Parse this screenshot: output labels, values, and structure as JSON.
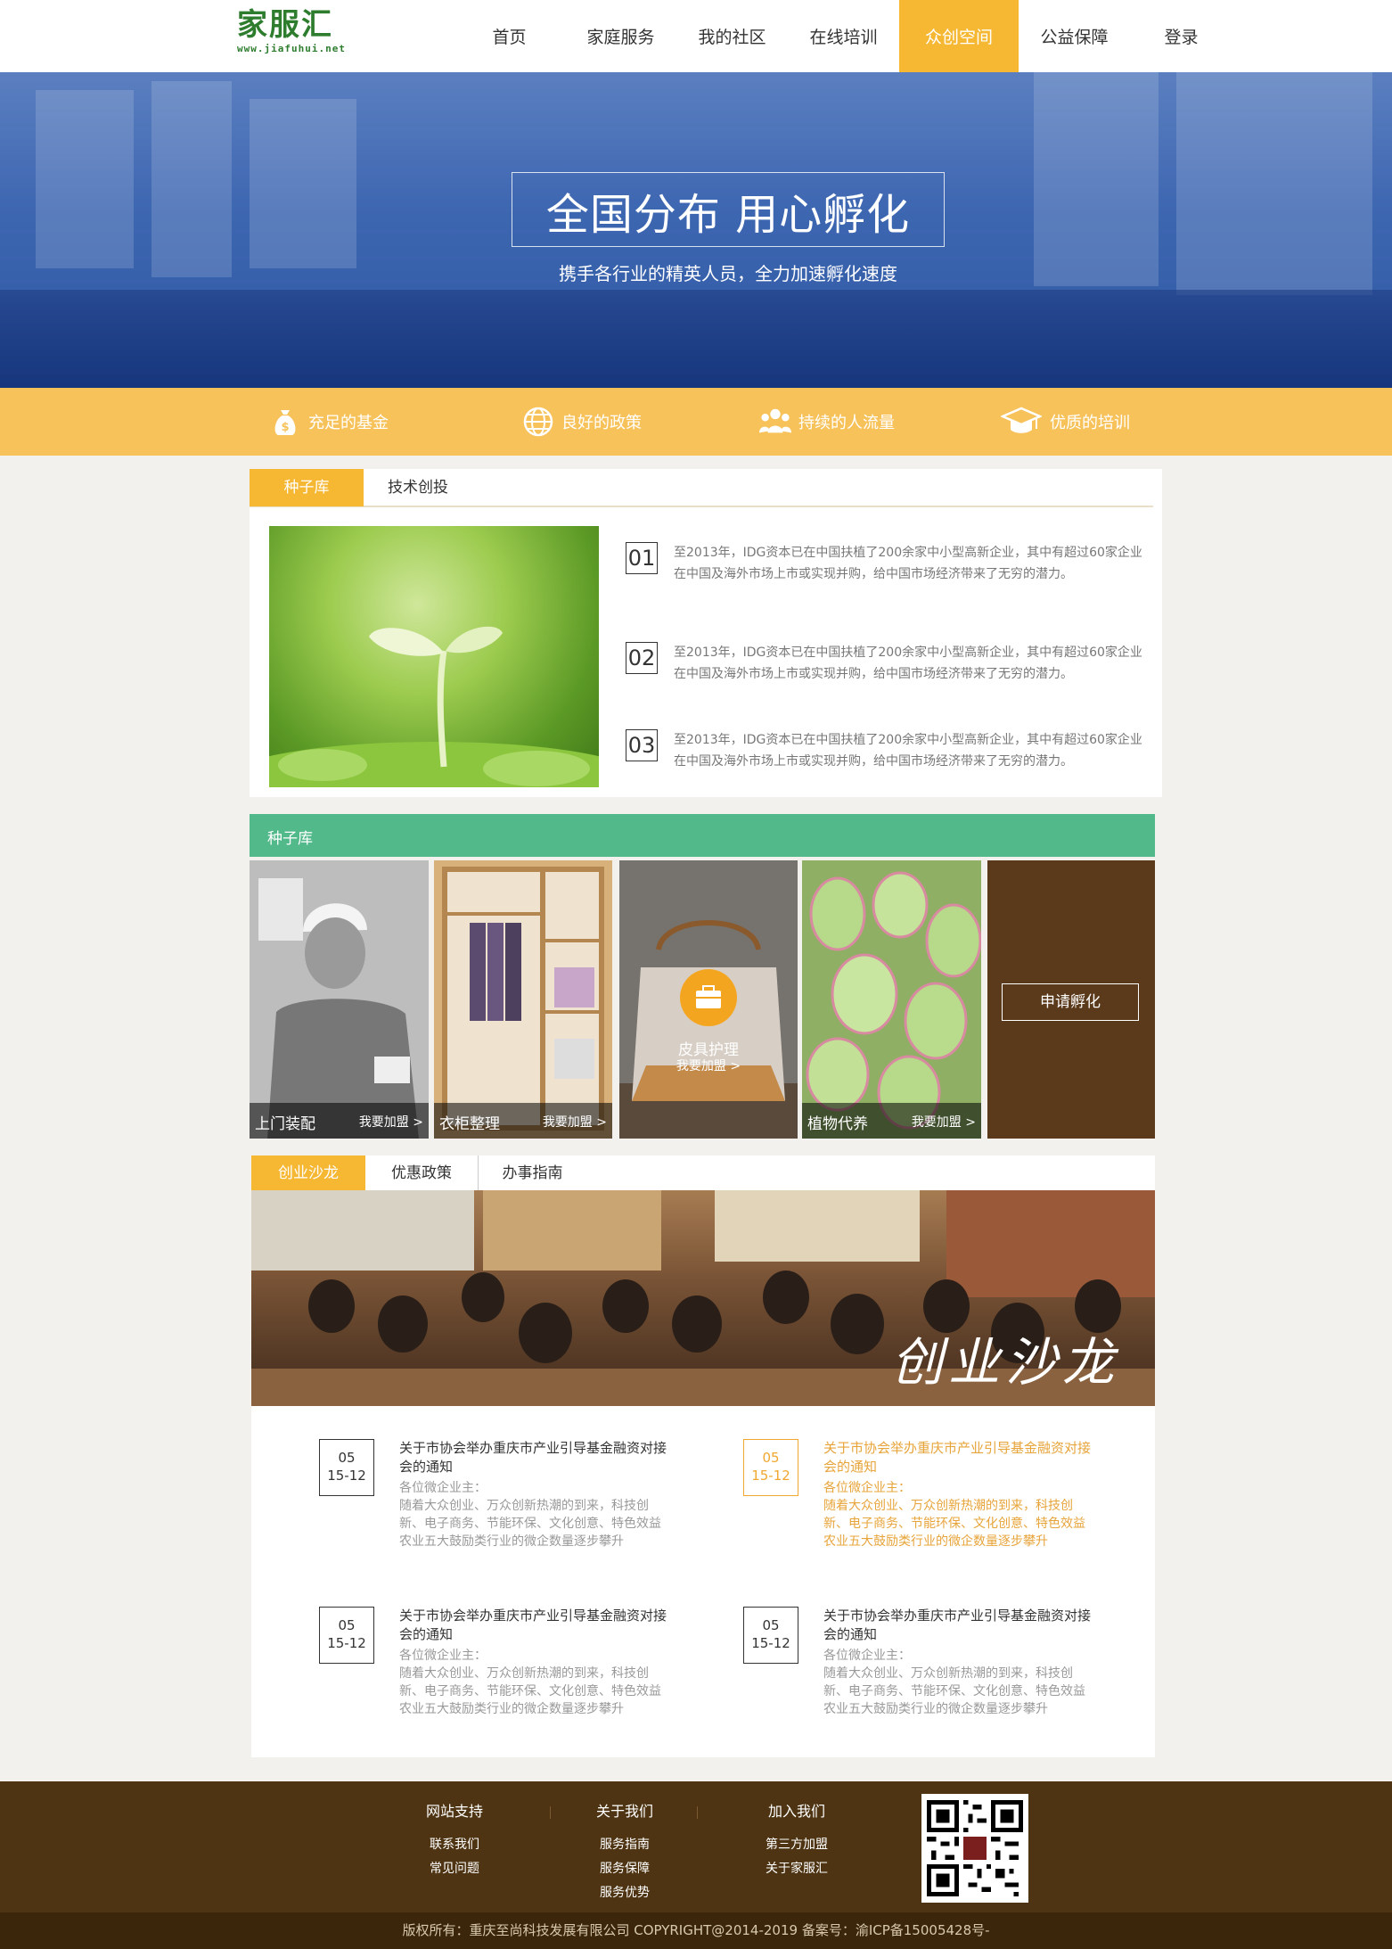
{
  "header": {
    "logo_text": "家服汇",
    "logo_url": "www.jiafuhui.net",
    "nav": [
      "首页",
      "家庭服务",
      "我的社区",
      "在线培训",
      "众创空间",
      "公益保障",
      "登录"
    ],
    "active_nav": "众创空间"
  },
  "banner": {
    "title": "全国分布 用心孵化",
    "subtitle": "携手各行业的精英人员，全力加速孵化速度"
  },
  "features": [
    {
      "label": "充足的基金",
      "icon": "money-bag-icon"
    },
    {
      "label": "良好的政策",
      "icon": "globe-icon"
    },
    {
      "label": "持续的人流量",
      "icon": "people-icon"
    },
    {
      "label": "优质的培训",
      "icon": "graduation-cap-icon"
    }
  ],
  "seed_section": {
    "tabs": [
      "种子库",
      "技术创投"
    ],
    "items": [
      {
        "num": "01",
        "text": "至2013年，IDG资本已在中国扶植了200余家中小型高新企业，其中有超过60家企业在中国及海外市场上市或实现并购，给中国市场经济带来了无穷的潜力。"
      },
      {
        "num": "02",
        "text": "至2013年，IDG资本已在中国扶植了200余家中小型高新企业，其中有超过60家企业在中国及海外市场上市或实现并购，给中国市场经济带来了无穷的潜力。"
      },
      {
        "num": "03",
        "text": "至2013年，IDG资本已在中国扶植了200余家中小型高新企业，其中有超过60家企业在中国及海外市场上市或实现并购，给中国市场经济带来了无穷的潜力。"
      }
    ]
  },
  "gallery": {
    "title": "种子库",
    "tiles": [
      {
        "label": "上门装配",
        "join": "我要加盟 >"
      },
      {
        "label": "衣柜整理",
        "join": "我要加盟 >"
      },
      {
        "label": "皮具护理",
        "join": "我要加盟 >"
      },
      {
        "label": "植物代养",
        "join": "我要加盟 >"
      }
    ],
    "apply": "申请孵化"
  },
  "salon_section": {
    "tabs": [
      "创业沙龙",
      "优惠政策",
      "办事指南"
    ],
    "banner_text": "创业沙龙",
    "news": [
      {
        "month": "05",
        "day": "15-12",
        "title": "关于市协会举办重庆市产业引导基金融资对接会的通知",
        "desc": "各位微企业主：\n随着大众创业、万众创新热潮的到来，科技创新、电子商务、节能环保、文化创意、特色效益农业五大鼓励类行业的微企数量逐步攀升"
      },
      {
        "month": "05",
        "day": "15-12",
        "title": "关于市协会举办重庆市产业引导基金融资对接会的通知",
        "desc": "各位微企业主：\n随着大众创业、万众创新热潮的到来，科技创新、电子商务、节能环保、文化创意、特色效益农业五大鼓励类行业的微企数量逐步攀升"
      },
      {
        "month": "05",
        "day": "15-12",
        "title": "关于市协会举办重庆市产业引导基金融资对接会的通知",
        "desc": "各位微企业主：\n随着大众创业、万众创新热潮的到来，科技创新、电子商务、节能环保、文化创意、特色效益农业五大鼓励类行业的微企数量逐步攀升"
      },
      {
        "month": "05",
        "day": "15-12",
        "title": "关于市协会举办重庆市产业引导基金融资对接会的通知",
        "desc": "各位微企业主：\n随着大众创业、万众创新热潮的到来，科技创新、电子商务、节能环保、文化创意、特色效益农业五大鼓励类行业的微企数量逐步攀升"
      }
    ]
  },
  "footer": {
    "columns": [
      {
        "title": "网站支持",
        "links": [
          "联系我们",
          "常见问题"
        ]
      },
      {
        "title": "关于我们",
        "links": [
          "服务指南",
          "服务保障",
          "服务优势"
        ]
      },
      {
        "title": "加入我们",
        "links": [
          "第三方加盟",
          "关于家服汇"
        ]
      }
    ],
    "copyright": "版权所有：重庆至尚科技发展有限公司 COPYRIGHT@2014-2019 备案号：渝ICP备15005428号-"
  },
  "colors": {
    "accent": "#f6b732",
    "green": "#52b98b",
    "brown": "#4e3412",
    "feature_bar": "#f7c25a"
  }
}
